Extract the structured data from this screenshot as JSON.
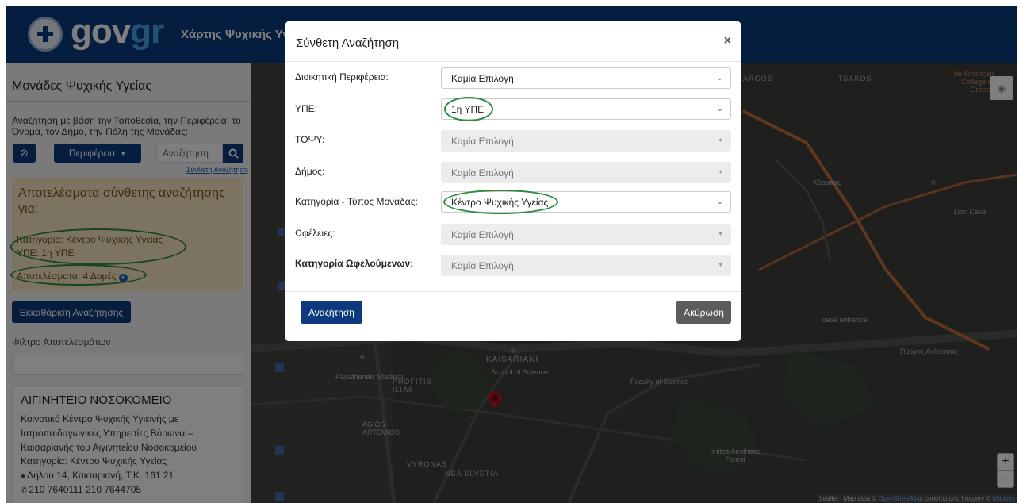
{
  "header": {
    "logo_main": "gov",
    "logo_accent": "gr",
    "title": "Χάρτης Ψυχικής Υγείας"
  },
  "sidebar": {
    "title": "Μονάδες Ψυχικής Υγείας",
    "search_description": "Αναζήτηση με βάση την Τοποθεσία, την Περιφέρεια, το Όνομα, τον Δήμο, την Πόλη της Μονάδας:",
    "locate_icon": "compass-icon",
    "region_button": "Περιφέρεια",
    "search_placeholder": "Αναζήτηση",
    "advanced_search_link": "Σύνθετη Αναζήτηση",
    "results": {
      "heading": "Αποτελέσματα σύνθετης αναζήτησης για:",
      "category": "Κατηγορία: Κέντρο Ψυχικής Υγείας",
      "ype": "ΥΠΕ: 1η ΥΠΕ",
      "count": "Αποτελέσματα: 4 Δομές"
    },
    "clear_button": "Εκκαθάριση Αναζήτησης",
    "filter_label": "Φίλτρο Αποτελεσμάτων",
    "filter_placeholder": "...",
    "facility": {
      "name": "ΑΙΓΙΝΗΤΕΙΟ ΝΟΣΟΚΟΜΕΙΟ",
      "description": "Κοινοτικό Κέντρο Ψυχικής Υγιεινής με Ιατροπαιδαγωγικές Υπηρεσίες Βύρωνα – Καισαριανής του Αιγινητείου Νοσοκομείου",
      "category": "Κατηγορία: Κέντρο Ψυχικής Υγείας",
      "address": "Δήλου 14, Καισαριανή, Τ.Κ. 161 21",
      "phone": "210 7640111 210 7644705"
    }
  },
  "map": {
    "labels": {
      "kaisariani": "KAISARIANI",
      "panathenaic": "Panathenaic Stadium",
      "profitis": "PROFITIS ILIAS",
      "school": "School of Science",
      "faculty": "Faculty of Science",
      "agios": "AGIOS ARTEMIOS",
      "vyronas": "VYRONAS",
      "nea_elvetia": "NEA ELVETIA",
      "tsakos": "TSAKOS",
      "argos": "ARGOS",
      "koropos": "Κόρακας",
      "pyrgos": "Πύργος Ανθούσας",
      "cave": "cave entrance",
      "lion_cave": "Lion Cave",
      "american": "The American College of Greece",
      "imittos": "Imitos Aesthetic Forest"
    },
    "attribution_prefix": "Leaflet | Map data ©",
    "attribution_osm": "OpenStreetMap",
    "attribution_mid": "contributors, Imagery ©",
    "attribution_mapbox": "Mapbox",
    "zoom_in": "+",
    "zoom_out": "−"
  },
  "modal": {
    "title": "Σύνθετη Αναζήτηση",
    "close": "×",
    "fields": [
      {
        "label": "Διοικητική Περιφέρεια:",
        "value": "Καμία Επιλογή"
      },
      {
        "label": "ΥΠΕ:",
        "value": "1η ΥΠΕ"
      },
      {
        "label": "ΤΟΨΥ:",
        "value": "Καμία Επιλογή"
      },
      {
        "label": "Δήμος:",
        "value": "Καμία Επιλογή"
      },
      {
        "label": "Κατηγορία - Τύπος Μονάδας:",
        "value": "Κέντρο Ψυχικής Υγείας"
      },
      {
        "label": "Ωφέλειες:",
        "value": "Καμία Επιλογή"
      },
      {
        "label": "Κατηγορία Ωφελούμενων:",
        "value": "Καμία Επιλογή"
      }
    ],
    "search_button": "Αναζήτηση",
    "cancel_button": "Ακύρωση"
  },
  "colors": {
    "brand_blue": "#0b3a7e",
    "highlight_green": "#2e8b3d",
    "results_bg": "#f9e8c2"
  }
}
